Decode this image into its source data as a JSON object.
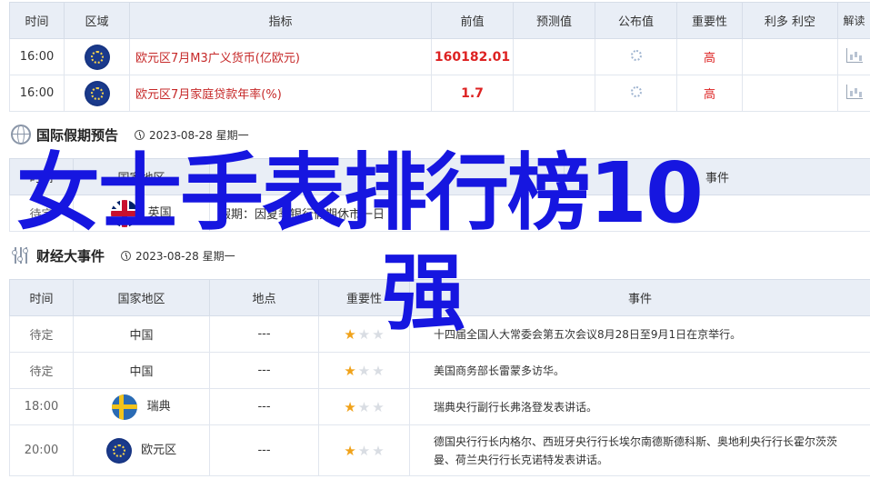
{
  "table1": {
    "headers": [
      "时间",
      "区域",
      "指标",
      "前值",
      "预测值",
      "公布值",
      "重要性",
      "利多 利空",
      "解读"
    ],
    "rows": [
      {
        "time": "16:00",
        "flag": "eu-flag-icon",
        "indicator": "欧元区7月M3广义货币(亿欧元)",
        "prev": "160182.01",
        "forecast": "",
        "actual_icon": "loading-icon",
        "importance": "高",
        "impact": "",
        "read_icon": "chart-icon"
      },
      {
        "time": "16:00",
        "flag": "eu-flag-icon",
        "indicator": "欧元区7月家庭贷款年率(%)",
        "prev": "1.7",
        "forecast": "",
        "actual_icon": "loading-icon",
        "importance": "高",
        "impact": "",
        "read_icon": "chart-icon"
      }
    ]
  },
  "holiday": {
    "icon": "globe-icon",
    "title": "国际假期预告",
    "date": "2023-08-28 星期一",
    "headers": [
      "时间",
      "国家地区",
      "",
      "事件"
    ],
    "rows": [
      {
        "time": "待定",
        "flag": "uk-flag-icon",
        "region": "英国",
        "event": "假期：因夏季银行假期休市一日"
      }
    ]
  },
  "events": {
    "icon": "sliders-icon",
    "title": "财经大事件",
    "date": "2023-08-28 星期一",
    "headers": [
      "时间",
      "国家地区",
      "地点",
      "重要性",
      "事件"
    ],
    "rows": [
      {
        "time": "待定",
        "flag": "",
        "region": "中国",
        "place": "---",
        "stars": 1,
        "event": "十四届全国人大常委会第五次会议8月28日至9月1日在京举行。"
      },
      {
        "time": "待定",
        "flag": "",
        "region": "中国",
        "place": "---",
        "stars": 1,
        "event": "美国商务部长雷蒙多访华。"
      },
      {
        "time": "18:00",
        "flag": "se-flag-icon",
        "region": "瑞典",
        "place": "---",
        "stars": 1,
        "event": "瑞典央行副行长弗洛登发表讲话。"
      },
      {
        "time": "20:00",
        "flag": "eu-flag-icon",
        "region": "欧元区",
        "place": "---",
        "stars": 1,
        "event": "德国央行行长内格尔、西班牙央行行长埃尔南德斯德科斯、奥地利央行行长霍尔茨茨曼、荷兰央行行长克诺特发表讲话。"
      }
    ]
  },
  "overlay": {
    "line1": "女士手表排行榜10",
    "line2": "强"
  },
  "colors": {
    "header_bg": "#e9eef6",
    "accent_red": "#d22222",
    "overlay_blue": "#1616e0",
    "star_on": "#f0a21a"
  }
}
